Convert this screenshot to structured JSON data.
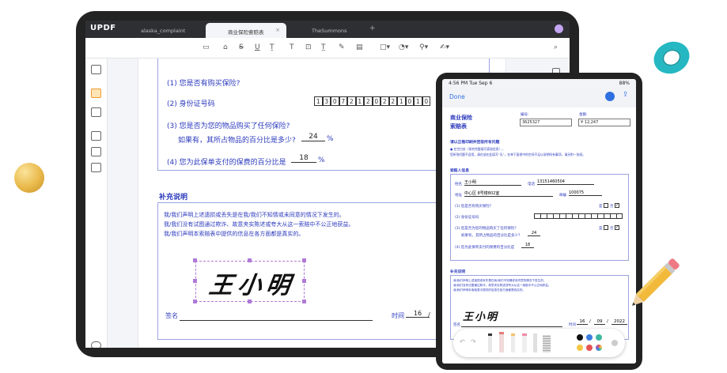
{
  "app": {
    "logo": "UPDF",
    "tabs": [
      "alaska_complaint",
      "商业保险索赔表",
      "TheSummons"
    ],
    "tab_close": "×",
    "tab_add": "+"
  },
  "form": {
    "q1": "(1) 您是否有购买保险?",
    "q1_yes": "是",
    "q2": "(2) 身份证号码",
    "id_digits": [
      "1",
      "3",
      "0",
      "7",
      "2",
      "1",
      "2",
      "0",
      "2",
      "2",
      "1",
      "0",
      "1",
      "0"
    ],
    "q3": "(3) 您是否为您的物品购买了任何保险?",
    "q3_sub": "如果有，其所占物品的百分比是多少?",
    "q3_val": "24",
    "q3_unit": "%",
    "q4": "(4) 您为此保单支付的保费的百分比是",
    "q4_val": "18",
    "q4_unit": "%",
    "supp_title": "补充说明",
    "supp_lines": [
      "我/我们声明上述遗损或丢失是在我/我们不知情或未同意的情况下发生的。",
      "我/我们没有试图通过欺诈、故意夹实陈述或夸大从这一索赔中不公正地获益。",
      "我/我们声明本索赔表中提供的信息在各方面都是真实的。"
    ],
    "sign_label": "签名",
    "signature": "王小明",
    "time_label": "时间",
    "time_day": "16",
    "time_sep": "/"
  },
  "ipad": {
    "status_time": "4:56 PM  Tue Sep 6",
    "status_right": "88%",
    "done": "Done",
    "form_title_1": "商业保险",
    "form_title_2": "索赔表",
    "serial_label": "编号:",
    "serial_val": "3625327",
    "amount_label": "金额:",
    "amount_val": "¥ 12,247",
    "instructions": "请以正楷印刷并回答所有问题",
    "note1": "● 在空白处（如何完整填写索赔信息）。",
    "note2": "您所答问题不适用，请在该在此填写“无”，在单下面框中的空间不足以说明所有事项，请另附一张纸。",
    "claimant_title": "索赔人信息",
    "name_label": "姓名",
    "name_val": "王小明",
    "phone_label": "电话",
    "phone_val": "13151460504",
    "addr_label": "地址",
    "addr_val": "中心区 8号楼802室",
    "zip_label": "邮编",
    "zip_val": "100075",
    "q1": "(1) 您是否有购买保险?",
    "yes": "是",
    "no": "否",
    "q2": "(2) 身份证号码",
    "q3": "(3) 您是否为您的物品购买了任何保险?",
    "q3_sub": "如果有，其所占物品的百分比是多少?",
    "q3_val": "24",
    "q4": "(4) 您为此保单支付的保费的百分比是",
    "q4_val": "18",
    "supp_title": "补充说明",
    "supp_lines": [
      "我/我们声明上述遗损或丢失是在我/我们不知情或未同意的情况下发生的。",
      "我/我们没有试图通过欺诈、故意夹实陈述或夸大从这一索赔中不公正地获益。",
      "我/我们声明本索赔表中提供的信息在各方面都是真实的。"
    ],
    "sign_label": "签名",
    "signature": "王小明",
    "time_label": "时间",
    "date_d": "16",
    "date_m": "09",
    "date_y": "2022",
    "sep": "/"
  },
  "colors": {
    "accent": "#2c3bbd",
    "selection": "#b07ad8",
    "ring": "#25b8c2",
    "palette": [
      "#111111",
      "#3d7de0",
      "#3fb8a0",
      "#f2c744",
      "#e55353",
      "#9b59d0"
    ]
  }
}
